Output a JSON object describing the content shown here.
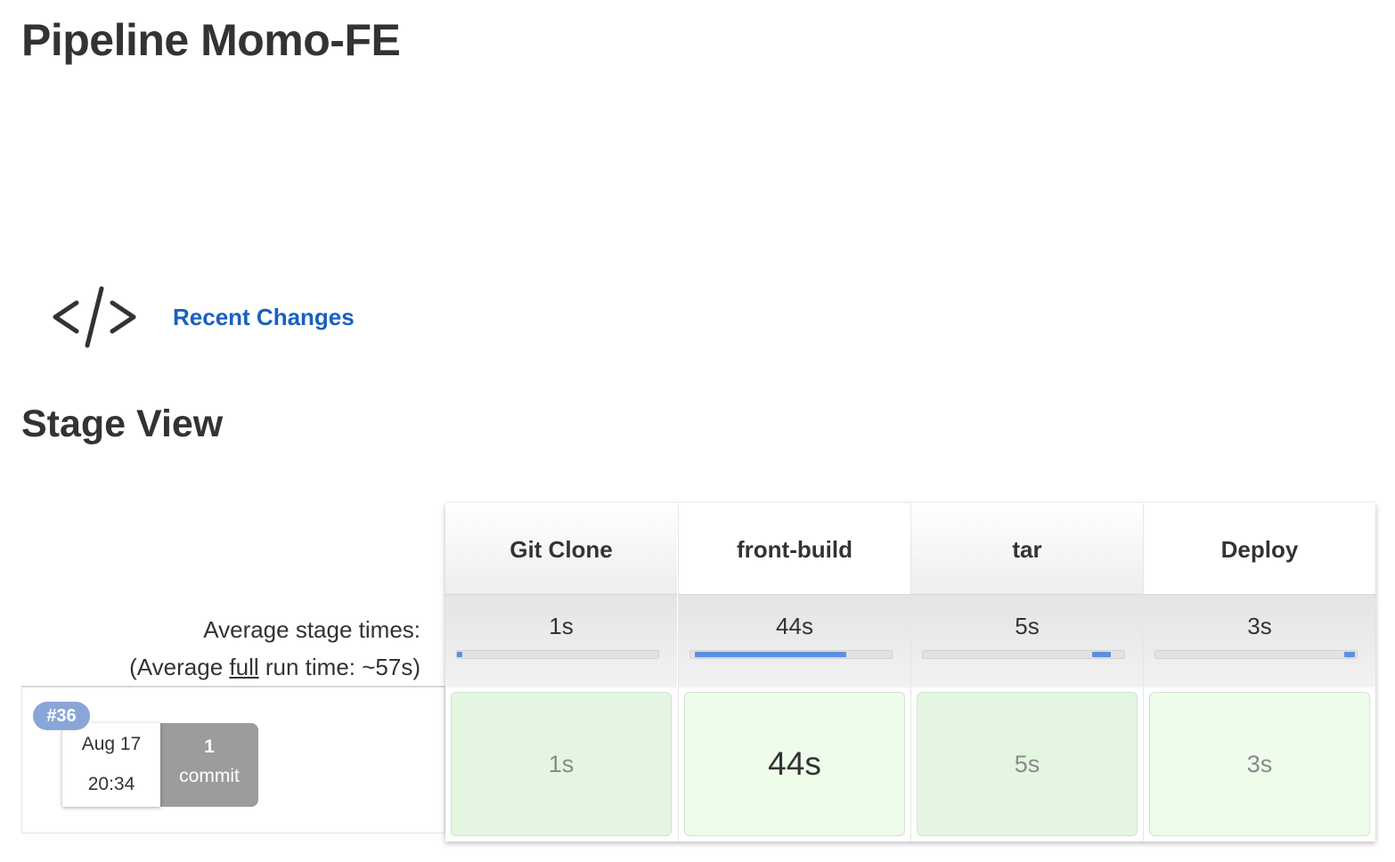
{
  "page": {
    "title": "Pipeline Momo-FE"
  },
  "sidebar": {
    "recent_changes": {
      "icon": "code-icon",
      "label": "Recent Changes"
    }
  },
  "stage_view": {
    "title": "Stage View",
    "average_label": "Average stage times:",
    "full_run_prefix": "(Average ",
    "full_run_word": "full",
    "full_run_suffix": " run time: ~57s)",
    "stages": [
      {
        "name": "Git Clone",
        "avg": "1s",
        "avg_share": 0.02
      },
      {
        "name": "front-build",
        "avg": "44s",
        "avg_share": 0.82
      },
      {
        "name": "tar",
        "avg": "5s",
        "avg_share": 0.1
      },
      {
        "name": "Deploy",
        "avg": "3s",
        "avg_share": 0.06
      }
    ],
    "runs": [
      {
        "build": "#36",
        "date": "Aug 17",
        "time": "20:34",
        "commit_count": "1",
        "commit_label": "commit",
        "durations": [
          "1s",
          "44s",
          "5s",
          "3s"
        ]
      }
    ]
  },
  "colors": {
    "link": "#1b5fbf",
    "badge": "#8aa6d8",
    "commit_box": "#9c9c9c",
    "success_cell": "#e4f5e2",
    "progress": "#5b8fe0"
  }
}
